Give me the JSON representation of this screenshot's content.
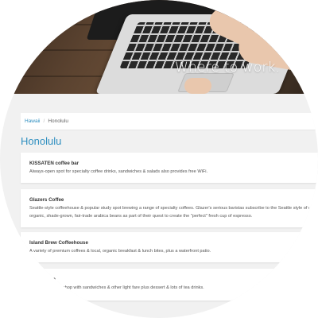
{
  "hero": {
    "title": "Where to work."
  },
  "breadcrumb": {
    "items": [
      "Hawaii",
      "Honolulu"
    ],
    "separator": "/"
  },
  "page": {
    "title": "Honolulu"
  },
  "listings": [
    {
      "name": "KISSATEN coffee bar",
      "description": [
        "Always-open spot for specialty coffee drinks, sandwiches & salads also provides free WiFi."
      ]
    },
    {
      "name": "Glazers Coffee",
      "description": [
        "Seattle-style coffeehouse & popular study spot brewing a range of specialty coffees. Glazer's serious baristas subscribe to the Seattle style of esprer",
        "organic, shade-grown, fair-trade arabica beans as part of their quest to create the \"perfect\" fresh cup of espresso."
      ]
    },
    {
      "name": "Island Brew Coffeehouse",
      "description": [
        "A variety of premium coffees & local, organic breakfast & lunch bites, plus a waterfront patio."
      ]
    },
    {
      "name": "...n",
      "description": [
        "...le & shop with sandwiches & other light fare plus dessert & lots of tea drinks."
      ]
    }
  ],
  "colors": {
    "accent": "#2f8fc0",
    "background": "#f1f1f1",
    "card": "#ffffff"
  }
}
